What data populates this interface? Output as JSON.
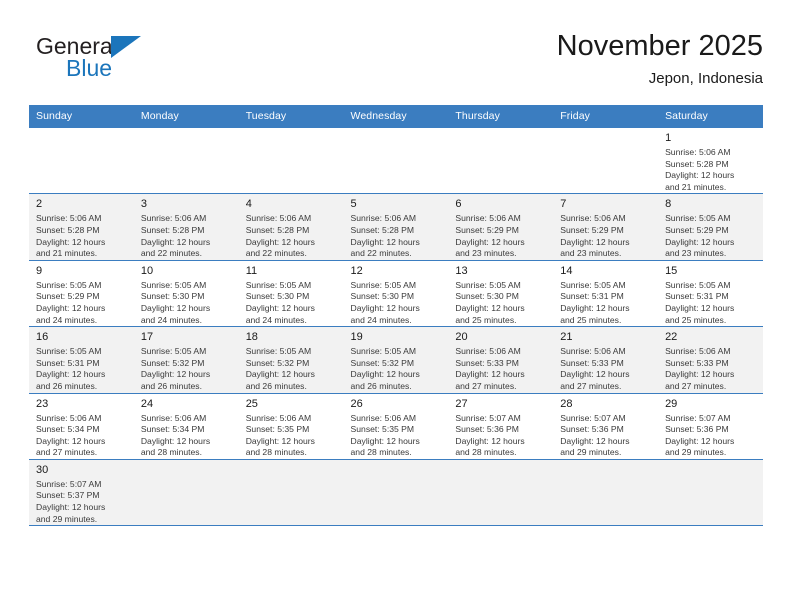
{
  "brand": {
    "line1": "General",
    "line2": "Blue",
    "accent_color": "#1b75bb",
    "triangle_icon": "triangle-icon"
  },
  "header": {
    "title": "November 2025",
    "subtitle": "Jepon, Indonesia"
  },
  "calendar": {
    "header_color": "#3b7dc0",
    "weekdays": [
      "Sunday",
      "Monday",
      "Tuesday",
      "Wednesday",
      "Thursday",
      "Friday",
      "Saturday"
    ],
    "weeks": [
      [
        {
          "day": "",
          "info": ""
        },
        {
          "day": "",
          "info": ""
        },
        {
          "day": "",
          "info": ""
        },
        {
          "day": "",
          "info": ""
        },
        {
          "day": "",
          "info": ""
        },
        {
          "day": "",
          "info": ""
        },
        {
          "day": "1",
          "info": "Sunrise: 5:06 AM\nSunset: 5:28 PM\nDaylight: 12 hours\nand 21 minutes."
        }
      ],
      [
        {
          "day": "2",
          "info": "Sunrise: 5:06 AM\nSunset: 5:28 PM\nDaylight: 12 hours\nand 21 minutes."
        },
        {
          "day": "3",
          "info": "Sunrise: 5:06 AM\nSunset: 5:28 PM\nDaylight: 12 hours\nand 22 minutes."
        },
        {
          "day": "4",
          "info": "Sunrise: 5:06 AM\nSunset: 5:28 PM\nDaylight: 12 hours\nand 22 minutes."
        },
        {
          "day": "5",
          "info": "Sunrise: 5:06 AM\nSunset: 5:28 PM\nDaylight: 12 hours\nand 22 minutes."
        },
        {
          "day": "6",
          "info": "Sunrise: 5:06 AM\nSunset: 5:29 PM\nDaylight: 12 hours\nand 23 minutes."
        },
        {
          "day": "7",
          "info": "Sunrise: 5:06 AM\nSunset: 5:29 PM\nDaylight: 12 hours\nand 23 minutes."
        },
        {
          "day": "8",
          "info": "Sunrise: 5:05 AM\nSunset: 5:29 PM\nDaylight: 12 hours\nand 23 minutes."
        }
      ],
      [
        {
          "day": "9",
          "info": "Sunrise: 5:05 AM\nSunset: 5:29 PM\nDaylight: 12 hours\nand 24 minutes."
        },
        {
          "day": "10",
          "info": "Sunrise: 5:05 AM\nSunset: 5:30 PM\nDaylight: 12 hours\nand 24 minutes."
        },
        {
          "day": "11",
          "info": "Sunrise: 5:05 AM\nSunset: 5:30 PM\nDaylight: 12 hours\nand 24 minutes."
        },
        {
          "day": "12",
          "info": "Sunrise: 5:05 AM\nSunset: 5:30 PM\nDaylight: 12 hours\nand 24 minutes."
        },
        {
          "day": "13",
          "info": "Sunrise: 5:05 AM\nSunset: 5:30 PM\nDaylight: 12 hours\nand 25 minutes."
        },
        {
          "day": "14",
          "info": "Sunrise: 5:05 AM\nSunset: 5:31 PM\nDaylight: 12 hours\nand 25 minutes."
        },
        {
          "day": "15",
          "info": "Sunrise: 5:05 AM\nSunset: 5:31 PM\nDaylight: 12 hours\nand 25 minutes."
        }
      ],
      [
        {
          "day": "16",
          "info": "Sunrise: 5:05 AM\nSunset: 5:31 PM\nDaylight: 12 hours\nand 26 minutes."
        },
        {
          "day": "17",
          "info": "Sunrise: 5:05 AM\nSunset: 5:32 PM\nDaylight: 12 hours\nand 26 minutes."
        },
        {
          "day": "18",
          "info": "Sunrise: 5:05 AM\nSunset: 5:32 PM\nDaylight: 12 hours\nand 26 minutes."
        },
        {
          "day": "19",
          "info": "Sunrise: 5:05 AM\nSunset: 5:32 PM\nDaylight: 12 hours\nand 26 minutes."
        },
        {
          "day": "20",
          "info": "Sunrise: 5:06 AM\nSunset: 5:33 PM\nDaylight: 12 hours\nand 27 minutes."
        },
        {
          "day": "21",
          "info": "Sunrise: 5:06 AM\nSunset: 5:33 PM\nDaylight: 12 hours\nand 27 minutes."
        },
        {
          "day": "22",
          "info": "Sunrise: 5:06 AM\nSunset: 5:33 PM\nDaylight: 12 hours\nand 27 minutes."
        }
      ],
      [
        {
          "day": "23",
          "info": "Sunrise: 5:06 AM\nSunset: 5:34 PM\nDaylight: 12 hours\nand 27 minutes."
        },
        {
          "day": "24",
          "info": "Sunrise: 5:06 AM\nSunset: 5:34 PM\nDaylight: 12 hours\nand 28 minutes."
        },
        {
          "day": "25",
          "info": "Sunrise: 5:06 AM\nSunset: 5:35 PM\nDaylight: 12 hours\nand 28 minutes."
        },
        {
          "day": "26",
          "info": "Sunrise: 5:06 AM\nSunset: 5:35 PM\nDaylight: 12 hours\nand 28 minutes."
        },
        {
          "day": "27",
          "info": "Sunrise: 5:07 AM\nSunset: 5:36 PM\nDaylight: 12 hours\nand 28 minutes."
        },
        {
          "day": "28",
          "info": "Sunrise: 5:07 AM\nSunset: 5:36 PM\nDaylight: 12 hours\nand 29 minutes."
        },
        {
          "day": "29",
          "info": "Sunrise: 5:07 AM\nSunset: 5:36 PM\nDaylight: 12 hours\nand 29 minutes."
        }
      ],
      [
        {
          "day": "30",
          "info": "Sunrise: 5:07 AM\nSunset: 5:37 PM\nDaylight: 12 hours\nand 29 minutes."
        },
        {
          "day": "",
          "info": ""
        },
        {
          "day": "",
          "info": ""
        },
        {
          "day": "",
          "info": ""
        },
        {
          "day": "",
          "info": ""
        },
        {
          "day": "",
          "info": ""
        },
        {
          "day": "",
          "info": ""
        }
      ]
    ]
  }
}
